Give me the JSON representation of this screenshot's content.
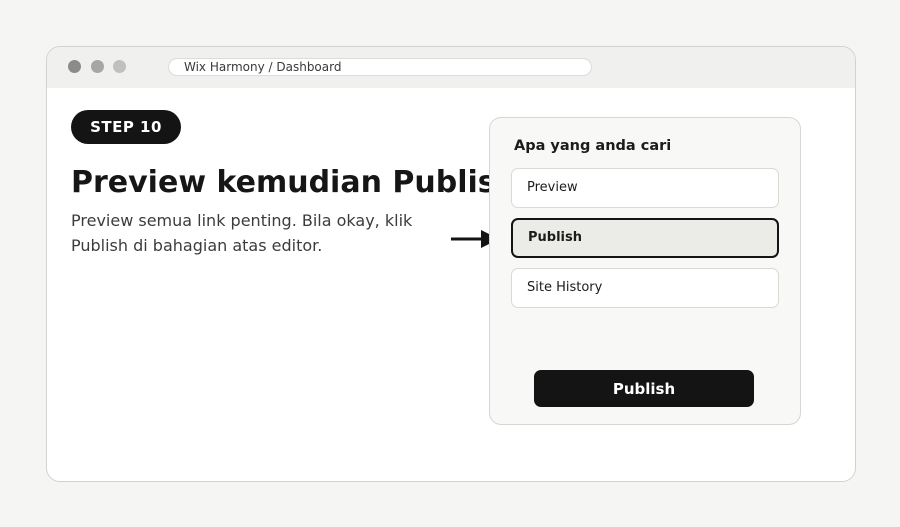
{
  "browser": {
    "url": "Wix Harmony / Dashboard"
  },
  "step": {
    "badge": "STEP 10",
    "title": "Preview kemudian Publish",
    "description": "Preview semua link penting. Bila okay, klik Publish di bahagian atas editor."
  },
  "panel": {
    "title": "Apa yang anda cari",
    "options": [
      {
        "label": "Preview",
        "selected": false
      },
      {
        "label": "Publish",
        "selected": true
      },
      {
        "label": "Site History",
        "selected": false
      }
    ],
    "publish_button": "Publish"
  },
  "icons": {
    "arrow": "arrow-right-icon"
  },
  "colors": {
    "accent": "#141414",
    "selected_bg": "#ebebe7",
    "page_bg": "#f5f5f3"
  }
}
